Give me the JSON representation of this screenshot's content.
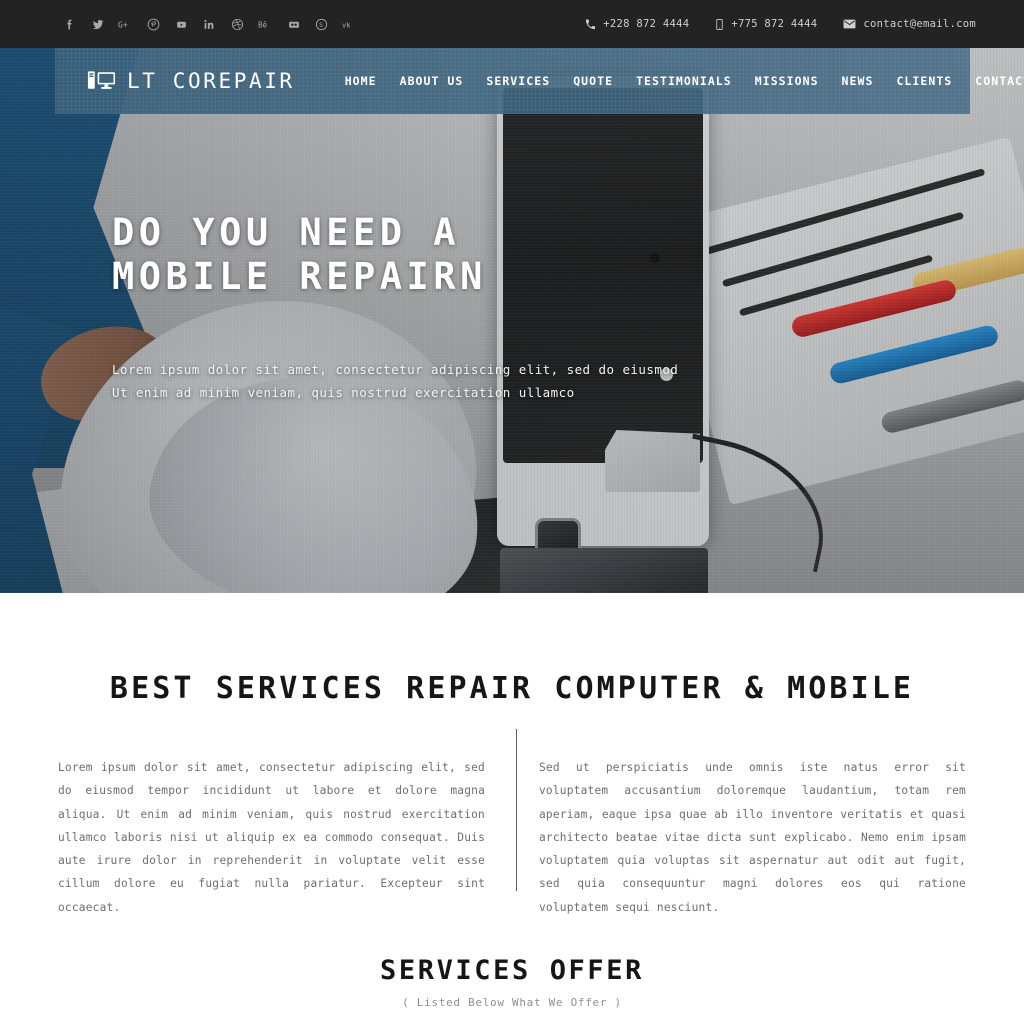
{
  "topbar": {
    "social": [
      {
        "name": "facebook-icon",
        "glyph": "f"
      },
      {
        "name": "twitter-icon",
        "glyph": "t"
      },
      {
        "name": "google-plus-icon",
        "glyph": "G+"
      },
      {
        "name": "pinterest-icon",
        "glyph": "P"
      },
      {
        "name": "youtube-icon",
        "glyph": "yt"
      },
      {
        "name": "linkedin-icon",
        "glyph": "in"
      },
      {
        "name": "dribbble-icon",
        "glyph": "db"
      },
      {
        "name": "behance-icon",
        "glyph": "Bē"
      },
      {
        "name": "flickr-icon",
        "glyph": "fl"
      },
      {
        "name": "skype-icon",
        "glyph": "S"
      },
      {
        "name": "vk-icon",
        "glyph": "vk"
      }
    ],
    "contacts": [
      {
        "icon": "phone-icon",
        "text": "+228 872 4444"
      },
      {
        "icon": "mobile-icon",
        "text": "+775 872 4444"
      },
      {
        "icon": "envelope-icon",
        "text": "contact@email.com"
      }
    ]
  },
  "navbar": {
    "brand": "LT COREPAIR",
    "brand_icon": "desktop-computer-icon",
    "menu": [
      "HOME",
      "ABOUT US",
      "SERVICES",
      "QUOTE",
      "TESTIMONIALS",
      "MISSIONS",
      "NEWS",
      "CLIENTS",
      "CONTACT US"
    ],
    "menu_toggle_icon": "hamburger-menu-icon",
    "background_color": "#3e647e"
  },
  "hero": {
    "title_line1": "DO YOU NEED A",
    "title_line2": "MOBILE REPAIRN",
    "subtitle_line1": "Lorem ipsum dolor sit amet, consectetur adipiscing elit, sed do eiusmod",
    "subtitle_line2": "Ut enim ad minim veniam, quis nostrud exercitation ullamco"
  },
  "best_services": {
    "title": "BEST SERVICES REPAIR COMPUTER & MOBILE",
    "paragraph_left": "Lorem ipsum dolor sit amet, consectetur adipiscing elit, sed do eiusmod tempor incididunt ut labore et dolore magna aliqua. Ut enim ad minim veniam, quis nostrud exercitation ullamco laboris nisi ut aliquip ex ea commodo consequat. Duis aute irure dolor in reprehenderit in voluptate velit esse cillum dolore eu fugiat nulla pariatur. Excepteur sint occaecat.",
    "paragraph_right": "Sed ut perspiciatis unde omnis iste natus error sit voluptatem accusantium doloremque laudantium, totam rem aperiam, eaque ipsa quae ab illo inventore veritatis et quasi architecto beatae vitae dicta sunt explicabo. Nemo enim ipsam voluptatem quia voluptas sit aspernatur aut odit aut fugit, sed quia consequuntur magni dolores eos qui ratione voluptatem sequi nesciunt."
  },
  "services_offer": {
    "title": "SERVICES OFFER",
    "subtitle": "( Listed Below What We Offer )"
  }
}
